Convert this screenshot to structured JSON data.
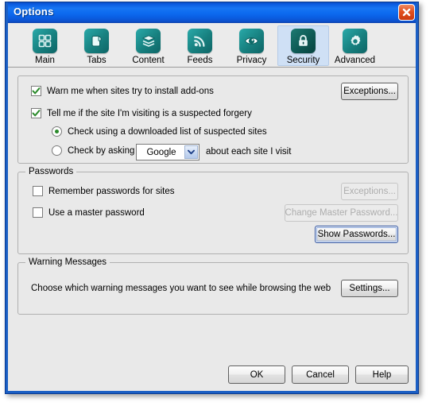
{
  "window": {
    "title": "Options",
    "close_icon": "close-icon"
  },
  "tabs": [
    {
      "label": "Main",
      "icon": "grid-icon",
      "selected": false
    },
    {
      "label": "Tabs",
      "icon": "tab-page-icon",
      "selected": false
    },
    {
      "label": "Content",
      "icon": "stack-icon",
      "selected": false
    },
    {
      "label": "Feeds",
      "icon": "rss-icon",
      "selected": false
    },
    {
      "label": "Privacy",
      "icon": "eye-icon",
      "selected": false
    },
    {
      "label": "Security",
      "icon": "lock-icon",
      "selected": true
    },
    {
      "label": "Advanced",
      "icon": "gear-icon",
      "selected": false
    }
  ],
  "security": {
    "warn_addons": {
      "label": "Warn me when sites try to install add-ons",
      "checked": true
    },
    "warn_addons_exceptions_button": "Exceptions...",
    "forgery": {
      "label": "Tell me if the site I'm visiting is a suspected forgery",
      "checked": true
    },
    "forgery_option_downloaded": {
      "label": "Check using a downloaded list of suspected sites",
      "selected": true
    },
    "forgery_option_ask": {
      "label": "Check by asking",
      "selected": false
    },
    "forgery_provider": "Google",
    "forgery_ask_suffix": "about each site I visit"
  },
  "passwords": {
    "group_title": "Passwords",
    "remember": {
      "label": "Remember passwords for sites",
      "checked": false
    },
    "remember_exceptions_button": "Exceptions...",
    "master": {
      "label": "Use a master password",
      "checked": false
    },
    "change_master_button": "Change Master Password...",
    "show_passwords_button": "Show Passwords..."
  },
  "warnings": {
    "group_title": "Warning Messages",
    "description": "Choose which warning messages you want to see while browsing the web",
    "settings_button": "Settings..."
  },
  "footer": {
    "ok": "OK",
    "cancel": "Cancel",
    "help": "Help"
  },
  "colors": {
    "titlebar_blue": "#1775f2",
    "window_border": "#1b5fc4",
    "icon_teal": "#17807f",
    "selected_tab": "#cfe0f5",
    "check_green": "#2a8a2a",
    "close_red": "#e2501f"
  }
}
